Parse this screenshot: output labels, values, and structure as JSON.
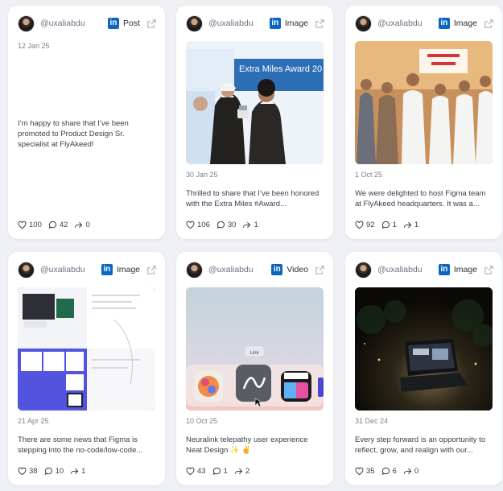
{
  "posts": [
    {
      "username": "@uxaliabdu",
      "network_icon": "linkedin-icon",
      "type": "Post",
      "date": "12 Jan 25",
      "text": "I’m happy to share that I’ve been promoted to Product Design Sr. specialist at FlyAkeed!",
      "likes": "100",
      "comments": "42",
      "shares": "0"
    },
    {
      "username": "@uxaliabdu",
      "network_icon": "linkedin-icon",
      "type": "Image",
      "date": "30 Jan 25",
      "text": "Thrilled to share that I’ve been honored with the Extra Miles #Award...",
      "likes": "106",
      "comments": "30",
      "shares": "1",
      "media_banner": "Extra Miles Award 20"
    },
    {
      "username": "@uxaliabdu",
      "network_icon": "linkedin-icon",
      "type": "Image",
      "date": "1 Oct 25",
      "text": "We were delighted to host Figma team at FlyAkeed headquarters. It was a...",
      "likes": "92",
      "comments": "1",
      "shares": "1"
    },
    {
      "username": "@uxaliabdu",
      "network_icon": "linkedin-icon",
      "type": "Image",
      "date": "21 Apr 25",
      "text": "There are some news that Figma is stepping into the no-code/low-code...",
      "likes": "38",
      "comments": "10",
      "shares": "1"
    },
    {
      "username": "@uxaliabdu",
      "network_icon": "linkedin-icon",
      "type": "Video",
      "date": "10 Oct 25",
      "text": "Neuralink telepathy user experience Neat Design ✨ ✌️",
      "likes": "43",
      "comments": "1",
      "shares": "2",
      "media_tooltip": "Link"
    },
    {
      "username": "@uxaliabdu",
      "network_icon": "linkedin-icon",
      "type": "Image",
      "date": "31 Dec 24",
      "text": "Every step forward is an opportunity to reflect, grow, and realign with our...",
      "likes": "35",
      "comments": "6",
      "shares": "0"
    }
  ],
  "colors": {
    "linkedin": "#0a66c2",
    "background": "#eef0f4",
    "card": "#ffffff"
  }
}
